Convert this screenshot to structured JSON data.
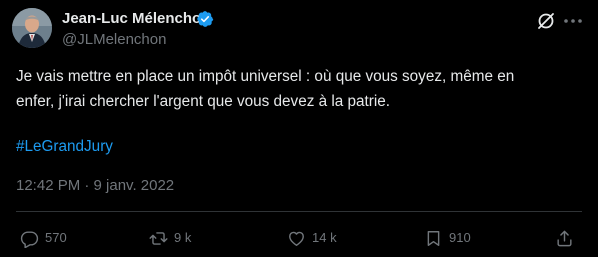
{
  "tweet": {
    "display_name": "Jean-Luc Mélenchon",
    "handle": "@JLMelenchon",
    "text_line1": "Je vais mettre en place un impôt universel : où que vous soyez, même en",
    "text_line2": "enfer, j'irai chercher l'argent que vous devez à la patrie.",
    "hashtag": "#LeGrandJury",
    "timestamp": "12:42 PM · 9 janv. 2022"
  },
  "actions": {
    "replies": "570",
    "reposts": "9 k",
    "likes": "14 k",
    "views": "910"
  },
  "icons": {
    "verified": "verified-badge-icon",
    "grok": "grok-icon",
    "more": "more-icon",
    "reply": "reply-icon",
    "repost": "repost-icon",
    "like": "like-icon",
    "views": "views-icon",
    "share": "share-icon"
  },
  "colors": {
    "background": "#000000",
    "text": "#e7e9ea",
    "muted": "#71767b",
    "accent": "#1d9bf0"
  }
}
